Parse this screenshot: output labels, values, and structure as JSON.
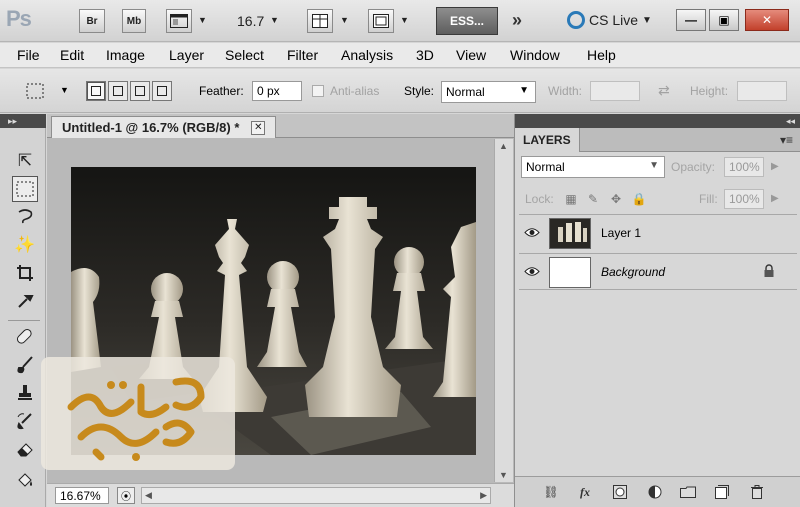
{
  "app": {
    "logo": "Ps",
    "bridge": "Br",
    "minibridge": "Mb",
    "zoom": "16.7",
    "workspace": "ESS...",
    "cslive": "CS Live"
  },
  "menu": [
    "File",
    "Edit",
    "Image",
    "Layer",
    "Select",
    "Filter",
    "Analysis",
    "3D",
    "View",
    "Window",
    "Help"
  ],
  "options": {
    "feather_label": "Feather:",
    "feather_value": "0 px",
    "antialias_label": "Anti-alias",
    "style_label": "Style:",
    "style_value": "Normal",
    "width_label": "Width:",
    "height_label": "Height:"
  },
  "document": {
    "tab_title": "Untitled-1 @ 16.7% (RGB/8) *",
    "zoom_status": "16.67%"
  },
  "layers_panel": {
    "tab": "LAYERS",
    "blend_mode": "Normal",
    "opacity_label": "Opacity:",
    "opacity_value": "100%",
    "lock_label": "Lock:",
    "fill_label": "Fill:",
    "fill_value": "100%",
    "layers": [
      {
        "name": "Layer 1",
        "visible": true
      },
      {
        "name": "Background",
        "visible": true,
        "locked": true
      }
    ]
  },
  "colors": {
    "accent_close": "#c2402b",
    "cslive_blue": "#2a7ab8",
    "workspace_button": "#5d5d5d"
  },
  "icons": {
    "toolbox": [
      "move-icon",
      "rect-marquee-icon",
      "lasso-icon",
      "magic-wand-icon",
      "crop-icon",
      "eyedropper-icon",
      "healing-brush-icon",
      "brush-icon",
      "clone-stamp-icon",
      "history-brush-icon",
      "eraser-icon",
      "paint-bucket-icon"
    ],
    "layers_footer": [
      "link-layers-icon",
      "fx-icon",
      "layer-mask-icon",
      "adjustment-layer-icon",
      "group-icon",
      "new-layer-icon",
      "trash-icon"
    ]
  }
}
